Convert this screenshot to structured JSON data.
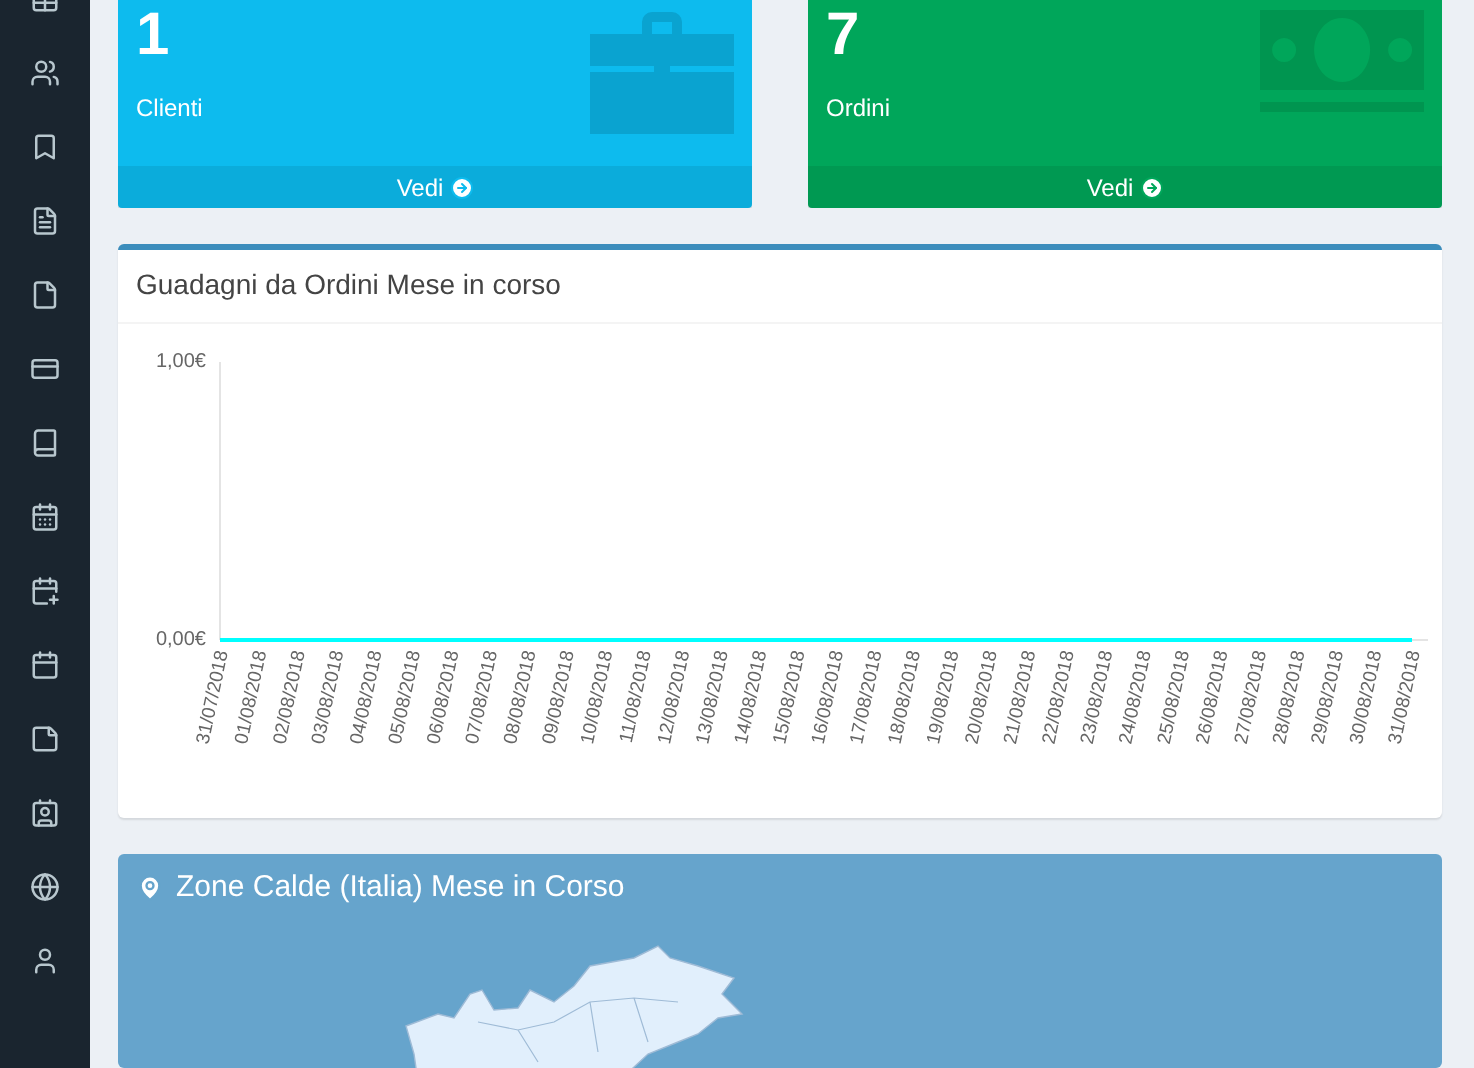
{
  "stat_cards": [
    {
      "value": "1",
      "label": "Clienti",
      "link": "Vedi",
      "kind": "briefcase",
      "color": "#0dbbee"
    },
    {
      "value": "7",
      "label": "Ordini",
      "link": "Vedi",
      "kind": "money",
      "color": "#00a65a"
    }
  ],
  "earnings_panel": {
    "title": "Guadagni da Ordini Mese in corso",
    "chart_data": {
      "type": "line",
      "categories": [
        "31/07/2018",
        "01/08/2018",
        "02/08/2018",
        "03/08/2018",
        "04/08/2018",
        "05/08/2018",
        "06/08/2018",
        "07/08/2018",
        "08/08/2018",
        "09/08/2018",
        "10/08/2018",
        "11/08/2018",
        "12/08/2018",
        "13/08/2018",
        "14/08/2018",
        "15/08/2018",
        "16/08/2018",
        "17/08/2018",
        "18/08/2018",
        "19/08/2018",
        "20/08/2018",
        "21/08/2018",
        "22/08/2018",
        "23/08/2018",
        "24/08/2018",
        "25/08/2018",
        "26/08/2018",
        "27/08/2018",
        "28/08/2018",
        "29/08/2018",
        "30/08/2018",
        "31/08/2018"
      ],
      "series": [
        {
          "color": "#00ffff",
          "values": [
            0,
            0,
            0,
            0,
            0,
            0,
            0,
            0,
            0,
            0,
            0,
            0,
            0,
            0,
            0,
            0,
            0,
            0,
            0,
            0,
            0,
            0,
            0,
            0,
            0,
            0,
            0,
            0,
            0,
            0,
            0,
            0
          ]
        }
      ],
      "ylim": [
        0,
        1
      ],
      "yticks": [
        {
          "value": 0,
          "label": "0,00€"
        },
        {
          "value": 1,
          "label": "1,00€"
        }
      ]
    }
  },
  "map_panel": {
    "title": "Zone Calde (Italia) Mese in Corso"
  }
}
